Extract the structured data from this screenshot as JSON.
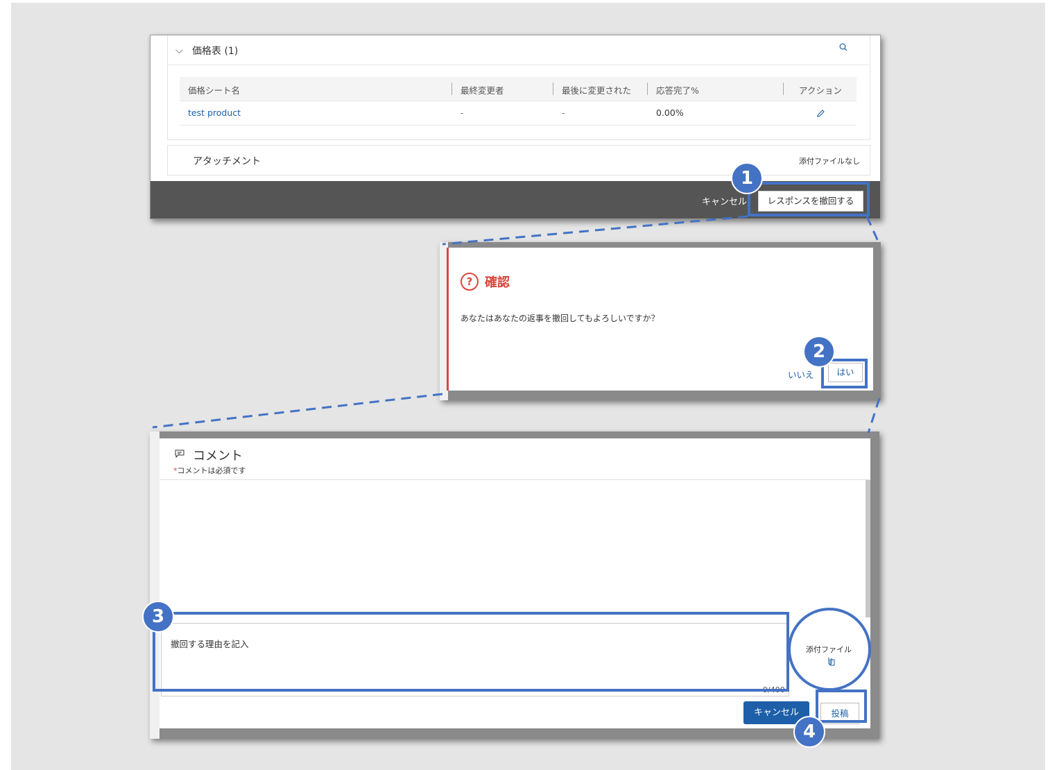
{
  "price_table": {
    "header_title": "価格表 (1)",
    "columns": [
      "価格シート名",
      "最終変更者",
      "最後に変更された",
      "応答完了%",
      "アクション"
    ],
    "rows": [
      {
        "name": "test product",
        "modified_by": "-",
        "modified_at": "-",
        "completion": "0.00%"
      }
    ],
    "attachment_label": "アタッチメント",
    "attachment_none": "添付ファイルなし",
    "footer_cancel": "キャンセル",
    "footer_retract": "レスポンスを撤回する"
  },
  "confirm_dialog": {
    "title": "確認",
    "message": "あなたはあなたの返事を撤回してもよろしいですか？",
    "no_label": "いいえ",
    "yes_label": "はい"
  },
  "comment_panel": {
    "title": "コメント",
    "required_star": "*",
    "required_text": "コメントは必須です",
    "input_value": "撤回する理由を記入",
    "char_count": "9/400",
    "attach_label": "添付ファイル",
    "cancel_label": "キャンセル",
    "post_label": "投稿"
  },
  "annotations": {
    "step1": "1",
    "step2": "2",
    "step3": "3",
    "step4": "4"
  },
  "colors": {
    "accent": "#4472c4",
    "link": "#1d5fa8",
    "alert": "#d9453b",
    "footer_bg": "#555555"
  }
}
